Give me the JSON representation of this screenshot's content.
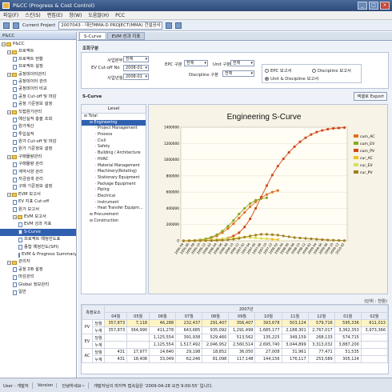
{
  "window": {
    "title": "P&CC (Progress & Cost Control)"
  },
  "menu": [
    "파일(F)",
    "스킨(S)",
    "편집(E)",
    "창(W)",
    "도움말(H)",
    "PCC"
  ],
  "projectbar": {
    "label": "Current Project",
    "value": "2007043 - 대산MMA-D PROJECT(MMA) 건설공사"
  },
  "sidebar": {
    "title": "P&CC",
    "items": [
      {
        "label": "P&CC",
        "lvl": 0,
        "type": "root"
      },
      {
        "label": "프로젝트",
        "lvl": 1,
        "type": "folder"
      },
      {
        "label": "프로젝트 현황",
        "lvl": 2,
        "type": "doc"
      },
      {
        "label": "프로젝트 설정",
        "lvl": 2,
        "type": "doc"
      },
      {
        "label": "공정데이터관리",
        "lvl": 1,
        "type": "folder"
      },
      {
        "label": "공정데이터 관리",
        "lvl": 2,
        "type": "doc"
      },
      {
        "label": "공정데이터 비교",
        "lvl": 2,
        "type": "doc"
      },
      {
        "label": "공정 Cut-off 및 마감",
        "lvl": 2,
        "type": "doc"
      },
      {
        "label": "공정 기준정보 설정",
        "lvl": 2,
        "type": "doc"
      },
      {
        "label": "직접원가관리",
        "lvl": 1,
        "type": "folder"
      },
      {
        "label": "예산실적 총괄 조회",
        "lvl": 2,
        "type": "doc"
      },
      {
        "label": "원가계산",
        "lvl": 2,
        "type": "doc"
      },
      {
        "label": "투입실적",
        "lvl": 2,
        "type": "doc"
      },
      {
        "label": "원가 Cut-off 및 마감",
        "lvl": 2,
        "type": "doc"
      },
      {
        "label": "원가 기준정보 설정",
        "lvl": 2,
        "type": "doc"
      },
      {
        "label": "구매물량관리",
        "lvl": 1,
        "type": "folder"
      },
      {
        "label": "구매물량 관리",
        "lvl": 2,
        "type": "doc"
      },
      {
        "label": "계약사양 관리",
        "lvl": 2,
        "type": "doc"
      },
      {
        "label": "자금검색 관리",
        "lvl": 2,
        "type": "doc"
      },
      {
        "label": "구매 기준정보 설정",
        "lvl": 2,
        "type": "doc"
      },
      {
        "label": "EVM 보고서",
        "lvl": 1,
        "type": "folder"
      },
      {
        "label": "EV 지표 Cut-off",
        "lvl": 2,
        "type": "doc"
      },
      {
        "label": "원가 보고서",
        "lvl": 2,
        "type": "doc"
      },
      {
        "label": "EVM 보고서",
        "lvl": 2,
        "type": "folder"
      },
      {
        "label": "EVM 성과 지표",
        "lvl": 3,
        "type": "doc"
      },
      {
        "label": "S-Curve",
        "lvl": 3,
        "type": "doc",
        "selected": true
      },
      {
        "label": "프로젝트 예정진도표",
        "lvl": 3,
        "type": "doc"
      },
      {
        "label": "종합 예정진도(SPI)",
        "lvl": 3,
        "type": "doc"
      },
      {
        "label": "EVM & Progress Summary",
        "lvl": 3,
        "type": "doc"
      },
      {
        "label": "관리자",
        "lvl": 1,
        "type": "folder"
      },
      {
        "label": "공정 DB 설정",
        "lvl": 2,
        "type": "doc"
      },
      {
        "label": "마감관리",
        "lvl": 2,
        "type": "doc"
      },
      {
        "label": "Global 정보관리",
        "lvl": 2,
        "type": "doc"
      },
      {
        "label": "일반",
        "lvl": 2,
        "type": "doc"
      }
    ]
  },
  "tabs": [
    "S-Curve",
    "EVM 성과 지표"
  ],
  "conditions": {
    "title": "조회구분",
    "f1_label": "사업본부",
    "f1_value": "전체",
    "f2_label": "EV Cut-off No",
    "f2_value": "2008-01",
    "f3_label": "사업년월",
    "f3_value": "2008-01",
    "epc_label": "EPC 구분",
    "epc_value": "전체",
    "unit_label": "Unit 구분",
    "unit_value": "전체",
    "disc_label": "Discipline 구분",
    "disc_value": "전체",
    "r1": "EPC 보고서",
    "r2": "Discipline 보고서",
    "r3": "Unit & Discipline 보고서"
  },
  "scurve_title": "S-Curve",
  "export_label": "엑셀로 Export",
  "level": {
    "header": "Level",
    "items": [
      {
        "label": "Total",
        "lvl": 0
      },
      {
        "label": "Engineering",
        "lvl": 1,
        "selected": true
      },
      {
        "label": "Project Management",
        "lvl": 2
      },
      {
        "label": "Process",
        "lvl": 2
      },
      {
        "label": "Civil",
        "lvl": 2
      },
      {
        "label": "Safety",
        "lvl": 2
      },
      {
        "label": "Building / Architecture",
        "lvl": 2
      },
      {
        "label": "HVAC",
        "lvl": 2
      },
      {
        "label": "Material Management",
        "lvl": 2
      },
      {
        "label": "Machinery(Rotating)",
        "lvl": 2
      },
      {
        "label": "Stationary Equipment",
        "lvl": 2
      },
      {
        "label": "Package Equipment",
        "lvl": 2
      },
      {
        "label": "Piping",
        "lvl": 2
      },
      {
        "label": "Electrical",
        "lvl": 2
      },
      {
        "label": "Instrument",
        "lvl": 2
      },
      {
        "label": "Heat Transfer Equipm...",
        "lvl": 2
      },
      {
        "label": "Procurement",
        "lvl": 1
      },
      {
        "label": "Construction",
        "lvl": 1
      }
    ]
  },
  "chart_data": {
    "type": "line",
    "title": "Engineering S-Curve",
    "yticks": [
      "1400000",
      "1200000",
      "1000000",
      "800000",
      "600000",
      "400000",
      "200000",
      "0"
    ],
    "ylim": [
      0,
      1400000
    ],
    "x": [
      "2005-04",
      "2005-06",
      "2005-08",
      "2005-10",
      "2005-12",
      "2006-02",
      "2006-04",
      "2006-06",
      "2006-08",
      "2006-10",
      "2006-12",
      "2007-02",
      "2007-04",
      "2007-06",
      "2007-08",
      "2007-10",
      "2007-12",
      "2008-02",
      "2008-04",
      "2008-06",
      "2008-08",
      "2008-10",
      "2008-12",
      "2009-02",
      "2009-04",
      "2009-06",
      "2009-08",
      "2009-10",
      "2009-12",
      "2010-02"
    ],
    "legend_position": "right",
    "series": [
      {
        "name": "cum_AC",
        "color": "#e07020",
        "values": [
          0,
          2000,
          5000,
          10000,
          20000,
          35000,
          60000,
          100000,
          150000,
          210000,
          280000,
          350000,
          420000,
          480000,
          530000,
          570000,
          600000,
          620000,
          null,
          null,
          null,
          null,
          null,
          null,
          null,
          null,
          null,
          null,
          null,
          null
        ]
      },
      {
        "name": "cum_EV",
        "color": "#8aa820",
        "values": [
          0,
          2000,
          5000,
          12000,
          25000,
          45000,
          75000,
          120000,
          180000,
          250000,
          330000,
          400000,
          460000,
          500000,
          520000,
          530000,
          null,
          null,
          null,
          null,
          null,
          null,
          null,
          null,
          null,
          null,
          null,
          null,
          null,
          null
        ]
      },
      {
        "name": "cum_PV",
        "color": "#d04818",
        "values": [
          0,
          1000,
          2000,
          3000,
          5000,
          8000,
          12000,
          20000,
          35000,
          60000,
          100000,
          170000,
          270000,
          400000,
          540000,
          680000,
          810000,
          920000,
          1010000,
          1090000,
          1160000,
          1220000,
          1270000,
          1310000,
          1340000,
          1360000,
          1375000,
          1385000,
          1390000,
          1395000
        ]
      },
      {
        "name": "cur_AC",
        "color": "#f0c020",
        "values": [
          0,
          1000,
          2000,
          4000,
          8000,
          12000,
          18000,
          25000,
          30000,
          35000,
          40000,
          45000,
          40000,
          35000,
          30000,
          25000,
          20000,
          15000,
          null,
          null,
          null,
          null,
          null,
          null,
          null,
          null,
          null,
          null,
          null,
          null
        ]
      },
      {
        "name": "cur_EV",
        "color": "#d8e060",
        "values": [
          0,
          1000,
          2000,
          4000,
          8000,
          12000,
          18000,
          25000,
          30000,
          35000,
          40000,
          45000,
          40000,
          35000,
          30000,
          25000,
          null,
          null,
          null,
          null,
          null,
          null,
          null,
          null,
          null,
          null,
          null,
          null,
          null,
          null
        ]
      },
      {
        "name": "cur_PV",
        "color": "#a08020",
        "values": [
          0,
          0,
          500,
          1000,
          2000,
          3000,
          5000,
          8000,
          12000,
          20000,
          30000,
          45000,
          60000,
          70000,
          80000,
          80000,
          75000,
          70000,
          60000,
          50000,
          40000,
          35000,
          30000,
          25000,
          20000,
          15000,
          10000,
          8000,
          5000,
          3000
        ]
      }
    ]
  },
  "unit_note": "(단위 : 천원)",
  "table": {
    "h_group": "측정요소",
    "year": "2007년",
    "months": [
      "04월",
      "05월",
      "06월",
      "07월",
      "08월",
      "09월",
      "10월",
      "11월",
      "12월",
      "01월",
      "02월"
    ],
    "rows": [
      {
        "g": "PV",
        "t": "당월",
        "v": [
          "357,873",
          "7,118",
          "46,288",
          "232,437",
          "291,407",
          "356,407",
          "393,678",
          "503,124",
          "579,716",
          "595,336",
          "611,013"
        ],
        "hl": true
      },
      {
        "g": "",
        "t": "누계",
        "v": [
          "357,873",
          "364,990",
          "411,278",
          "643,685",
          "935,092",
          "1,291,499",
          "1,685,177",
          "2,188,301",
          "2,767,017",
          "3,362,353",
          "3,973,366"
        ]
      },
      {
        "g": "EV",
        "t": "당월",
        "v": [
          "",
          "",
          "1,125,554",
          "391,938",
          "529,460",
          "513,562",
          "135,225",
          "349,159",
          "268,133",
          "574,715",
          ""
        ]
      },
      {
        "g": "",
        "t": "누계",
        "v": [
          "",
          "",
          "1,125,554",
          "1,517,492",
          "2,046,952",
          "2,560,514",
          "2,695,740",
          "3,044,899",
          "3,313,032",
          "3,887,200",
          ""
        ]
      },
      {
        "g": "AC",
        "t": "당월",
        "v": [
          "431",
          "17,977",
          "14,640",
          "29,198",
          "18,852",
          "36,050",
          "27,008",
          "31,961",
          "77,471",
          "51,535",
          ""
        ]
      },
      {
        "g": "",
        "t": "누계",
        "v": [
          "431",
          "18,408",
          "33,049",
          "62,246",
          "81,098",
          "117,148",
          "144,156",
          "176,117",
          "253,589",
          "305,124",
          ""
        ]
      }
    ]
  },
  "statusbar": {
    "user": "User : 개발자",
    "version": "Version",
    "msg": "안녕하세요~",
    "msg2": "개발자님의 마지막 접속일은 '2009-04-28 오전 9:00:55' 입니다."
  }
}
